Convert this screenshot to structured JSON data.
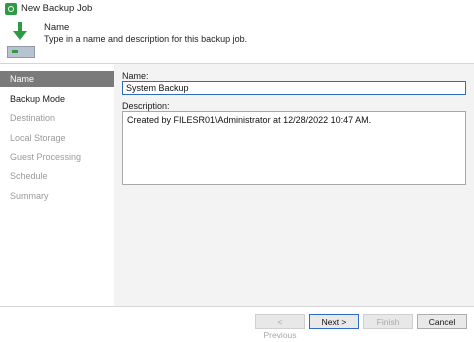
{
  "window": {
    "title": "New Backup Job"
  },
  "header": {
    "title": "Name",
    "description": "Type in a name and description for this backup job."
  },
  "sidebar": {
    "items": [
      {
        "label": "Name",
        "state": "active"
      },
      {
        "label": "Backup Mode",
        "state": "enabled"
      },
      {
        "label": "Destination",
        "state": "disabled"
      },
      {
        "label": "Local Storage",
        "state": "disabled"
      },
      {
        "label": "Guest Processing",
        "state": "disabled"
      },
      {
        "label": "Schedule",
        "state": "disabled"
      },
      {
        "label": "Summary",
        "state": "disabled"
      }
    ]
  },
  "form": {
    "name_label": "Name:",
    "name_value": "System Backup",
    "description_label": "Description:",
    "description_value": "Created by FILESR01\\Administrator at 12/28/2022 10:47 AM."
  },
  "footer": {
    "previous": "< Previous",
    "next": "Next >",
    "finish": "Finish",
    "cancel": "Cancel"
  },
  "colors": {
    "accent": "#2d6bc4",
    "active_nav": "#7a7a7a",
    "brand_green": "#2e9a43"
  }
}
